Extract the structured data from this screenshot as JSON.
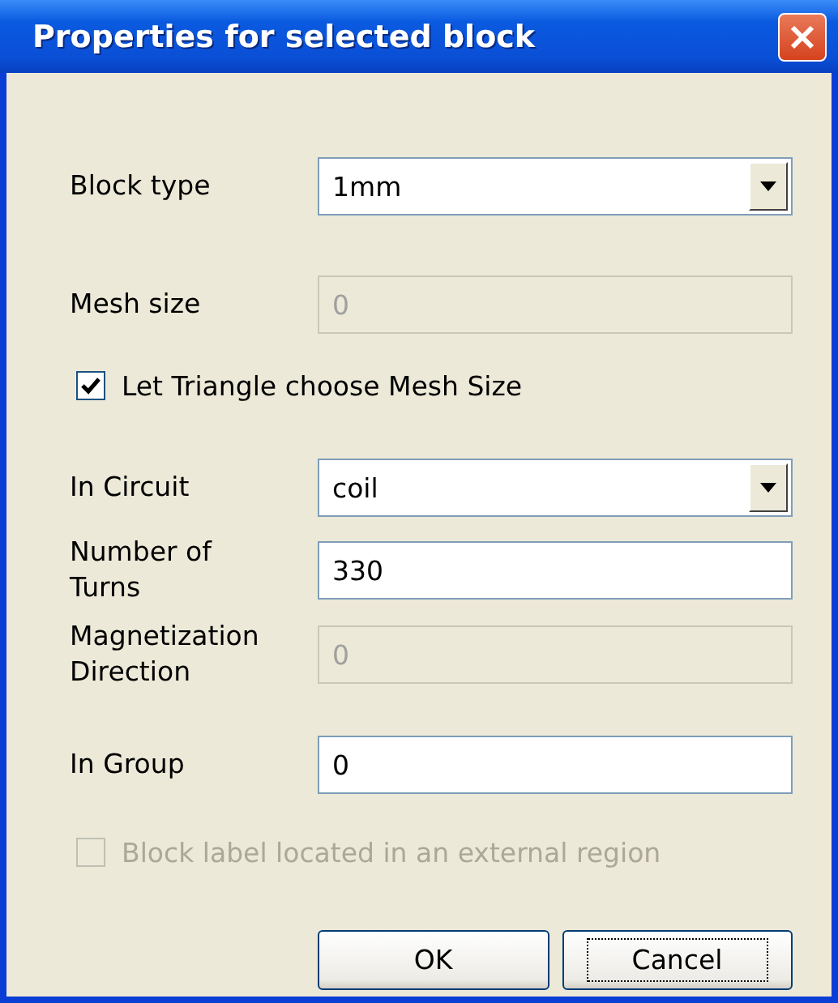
{
  "window": {
    "title": "Properties for selected block"
  },
  "fields": [
    {
      "kind": "dropdown",
      "label": "Block type",
      "value": "1mm",
      "disabled": false
    },
    {
      "kind": "text",
      "label": "Mesh size",
      "value": "0",
      "disabled": true
    },
    {
      "kind": "checkbox",
      "label": "Let Triangle choose Mesh Size",
      "checked": true,
      "disabled": false
    },
    {
      "kind": "dropdown",
      "label": "In Circuit",
      "value": "coil",
      "disabled": false
    },
    {
      "kind": "text",
      "label": "Number of\nTurns",
      "value": "330",
      "disabled": false
    },
    {
      "kind": "text",
      "label": "Magnetization\nDirection",
      "value": "0",
      "disabled": true
    },
    {
      "kind": "text",
      "label": "In Group",
      "value": "0",
      "disabled": false
    },
    {
      "kind": "checkbox",
      "label": "Block label located in an external region",
      "checked": false,
      "disabled": true
    }
  ],
  "buttons": [
    {
      "label": "OK",
      "focused": false
    },
    {
      "label": "Cancel",
      "focused": true
    }
  ]
}
